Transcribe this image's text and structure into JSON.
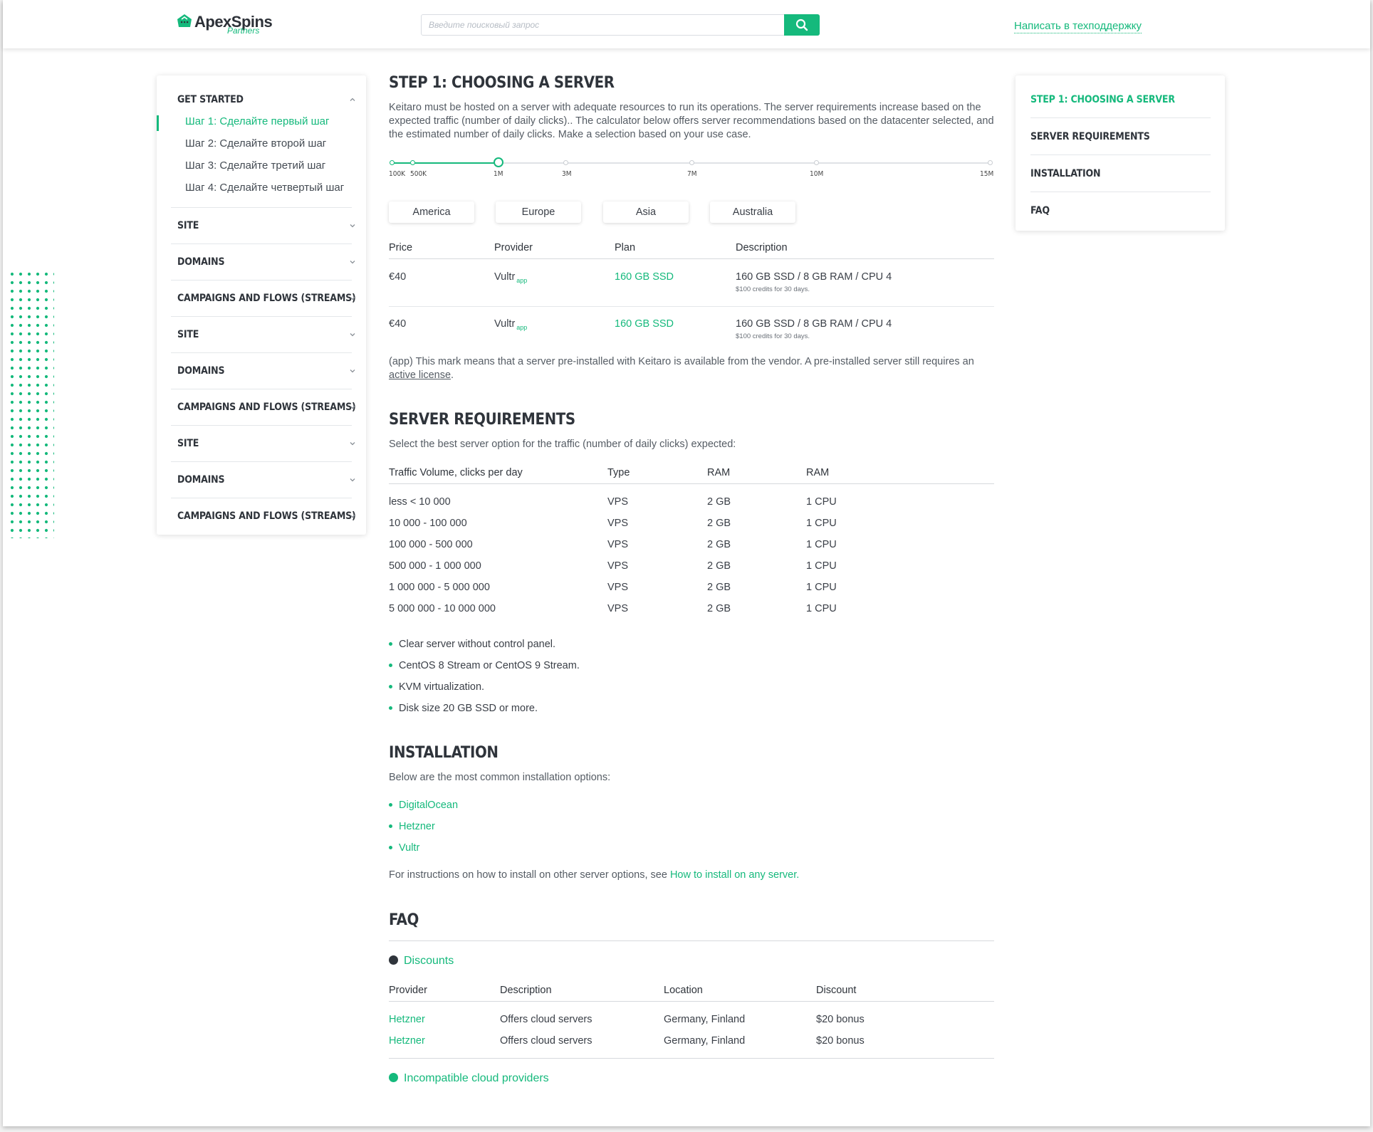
{
  "brand": {
    "name": "ApexSpins",
    "sub": "Partners",
    "accent": "#15b97c"
  },
  "header": {
    "search_placeholder": "Введите поисковый запрос",
    "search_icon": "search-icon",
    "support_link": "Написать в техподдержку"
  },
  "sidebar": {
    "sections": [
      {
        "title": "GET STARTED",
        "expanded": true,
        "items": [
          "Шаг 1: Сделайте первый шаг",
          "Шаг 2: Сделайте второй шаг",
          "Шаг 3: Сделайте третий шаг",
          "Шаг 4: Сделайте четвертый шаг"
        ]
      },
      {
        "title": "SITE"
      },
      {
        "title": "DOMAINS"
      },
      {
        "title": "CAMPAIGNS AND FLOWS (STREAMS)"
      },
      {
        "title": "SITE"
      },
      {
        "title": "DOMAINS"
      },
      {
        "title": "CAMPAIGNS AND FLOWS (STREAMS)"
      },
      {
        "title": "SITE"
      },
      {
        "title": "DOMAINS"
      },
      {
        "title": "CAMPAIGNS AND FLOWS (STREAMS)"
      }
    ]
  },
  "step1": {
    "title": "STEP 1: CHOOSING A SERVER",
    "intro": "Keitaro must be hosted on a server with adequate resources to run its operations. The server requirements increase based on the expected traffic (number of daily clicks).. The calculator below offers server recommendations based on the datacenter selected, and the estimated number of daily clicks. Make a selection based on your use case.",
    "slider": {
      "labels": [
        "100K",
        "500K",
        "1M",
        "3M",
        "7M",
        "10M",
        "15M"
      ],
      "selected": "1M"
    },
    "regions": [
      "America",
      "Europe",
      "Asia",
      "Australia"
    ],
    "table": {
      "headers": [
        "Price",
        "Provider",
        "Plan",
        "Description"
      ],
      "rows": [
        {
          "price": "€40",
          "provider": "Vultr",
          "tag": "app",
          "plan": "160 GB SSD",
          "desc": "160 GB SSD / 8 GB RAM / CPU 4",
          "note": "$100 credits for 30 days."
        },
        {
          "price": "€40",
          "provider": "Vultr",
          "tag": "app",
          "plan": "160 GB SSD",
          "desc": "160 GB SSD / 8 GB RAM / CPU 4",
          "note": "$100 credits for 30 days."
        }
      ]
    },
    "footnote_a": "(app) This mark means that a server pre-installed with Keitaro is available from the vendor. A pre-installed server still requires an",
    "footnote_link": "active license",
    "footnote_end": "."
  },
  "requirements": {
    "title": "SERVER REQUIREMENTS",
    "intro": "Select the best server option for the traffic (number of daily clicks) expected:",
    "headers": [
      "Traffic Volume, clicks per day",
      "Type",
      "RAM",
      "RAM"
    ],
    "rows": [
      [
        "less < 10 000",
        "VPS",
        "2 GB",
        "1 CPU"
      ],
      [
        "10 000 - 100 000",
        "VPS",
        "2 GB",
        "1 CPU"
      ],
      [
        "100 000 - 500 000",
        "VPS",
        "2 GB",
        "1 CPU"
      ],
      [
        "500 000 - 1 000 000",
        "VPS",
        "2 GB",
        "1 CPU"
      ],
      [
        "1 000 000 - 5 000 000",
        "VPS",
        "2 GB",
        "1 CPU"
      ],
      [
        "5 000 000 - 10 000 000",
        "VPS",
        "2 GB",
        "1 CPU"
      ]
    ],
    "bullets": [
      "Clear server without control panel.",
      "CentOS 8 Stream or CentOS 9 Stream.",
      "KVM virtualization.",
      "Disk size 20 GB SSD or more."
    ]
  },
  "installation": {
    "title": "INSTALLATION",
    "intro": "Below are the most common installation options:",
    "links": [
      "DigitalOcean",
      "Hetzner",
      "Vultr"
    ],
    "outro": "For instructions on how to install on other server options, see",
    "outro_link": "How to install on any server."
  },
  "faq": {
    "title": "FAQ",
    "q1": "Discounts",
    "headers": [
      "Provider",
      "Description",
      "Location",
      "Discount"
    ],
    "rows": [
      [
        "Hetzner",
        "Offers cloud servers",
        "Germany, Finland",
        "$20 bonus"
      ],
      [
        "Hetzner",
        "Offers cloud servers",
        "Germany, Finland",
        "$20 bonus"
      ]
    ],
    "q2": "Incompatible cloud providers"
  },
  "toc": {
    "items": [
      "STEP 1: CHOOSING A SERVER",
      "SERVER REQUIREMENTS",
      "INSTALLATION",
      "FAQ"
    ]
  }
}
